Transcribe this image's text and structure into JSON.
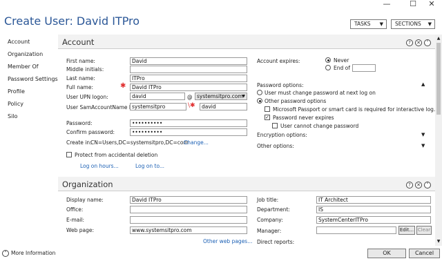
{
  "window": {
    "minimize": "—",
    "maximize": "☐",
    "close": "✕"
  },
  "title": "Create User: David ITPro",
  "top": {
    "tasks": "TASKS",
    "sections": "SECTIONS"
  },
  "nav": [
    "Account",
    "Organization",
    "Member Of",
    "Password Settings",
    "Profile",
    "Policy",
    "Silo"
  ],
  "account": {
    "title": "Account",
    "first_name_label": "First name:",
    "first_name": "David",
    "middle_label": "Middle initials:",
    "middle": "",
    "last_name_label": "Last name:",
    "last_name": "ITPro",
    "full_name_label": "Full name:",
    "full_name": "David ITPro",
    "upn_label": "User UPN logon:",
    "upn": "david",
    "at": "@",
    "domain": "systemsitpro.com",
    "sam_label": "User SamAccountName l...",
    "sam_domain": "systemsitpro",
    "backslash": "\\",
    "sam": "david",
    "password_label": "Password:",
    "password": "••••••••••",
    "confirm_label": "Confirm password:",
    "confirm": "••••••••••",
    "create_in_label": "Create in:",
    "create_in": "CN=Users,DC=systemsitpro,DC=com",
    "change_link": "Change...",
    "protect_label": "Protect from accidental deletion",
    "logon_hours": "Log on hours...",
    "logon_to": "Log on to...",
    "expires_label": "Account expires:",
    "never": "Never",
    "end_of": "End of",
    "pw_options_label": "Password options:",
    "must_change": "User must change password at next log on",
    "other_pw": "Other password options",
    "passport": "Microsoft Passport or smart card is required for interactive log...",
    "never_expires": "Password never expires",
    "cannot_change": "User cannot change password",
    "encryption": "Encryption options:",
    "other_options": "Other options:"
  },
  "org": {
    "title": "Organization",
    "display_label": "Display name:",
    "display": "David ITPro",
    "office_label": "Office:",
    "office": "",
    "email_label": "E-mail:",
    "email": "",
    "web_label": "Web page:",
    "web": "www.systemsitpro.com",
    "other_web": "Other web pages...",
    "job_label": "Job title:",
    "job": "IT Architect",
    "dept_label": "Department:",
    "dept": "IS",
    "company_label": "Company:",
    "company": "SystemCenterITPro",
    "manager_label": "Manager:",
    "manager": "",
    "edit": "Edit...",
    "clear": "Clear",
    "direct_label": "Direct reports:"
  },
  "bottom": {
    "more_info": "More Information",
    "ok": "OK",
    "cancel": "Cancel"
  },
  "icons": {
    "help": "?",
    "close": "✕",
    "collapse": "˄"
  }
}
